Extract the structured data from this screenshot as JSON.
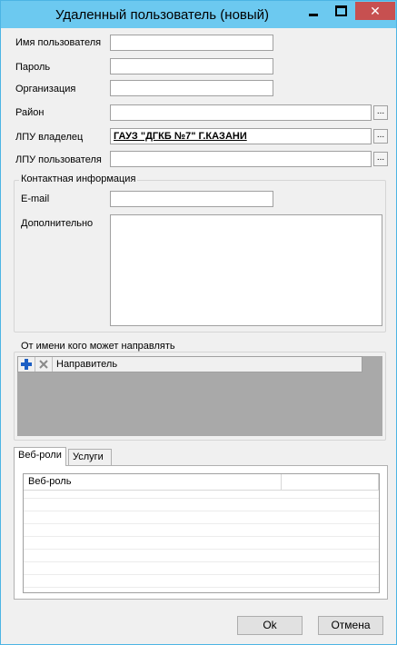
{
  "window": {
    "title": "Удаленный пользователь (новый)",
    "close_glyph": "✕"
  },
  "form": {
    "username_label": "Имя пользователя",
    "username_value": "",
    "password_label": "Пароль",
    "password_value": "",
    "organization_label": "Организация",
    "organization_value": "",
    "district_label": "Район",
    "district_value": "",
    "lpu_owner_label": "ЛПУ владелец",
    "lpu_owner_value": "ГАУЗ \"ДГКБ №7\" Г.КАЗАНИ",
    "lpu_user_label": "ЛПУ пользователя",
    "lpu_user_value": "",
    "picker_glyph": "..."
  },
  "contact": {
    "group_title": "Контактная информация",
    "email_label": "E-mail",
    "email_value": "",
    "additional_label": "Дополнительно",
    "additional_value": ""
  },
  "senders": {
    "group_title": "От имени кого может направлять",
    "column": "Направитель",
    "add_icon": "plus-icon",
    "delete_icon": "delete-icon"
  },
  "tabs": [
    {
      "label": "Веб-роли",
      "active": true
    },
    {
      "label": "Услуги",
      "active": false
    }
  ],
  "web_roles_table": {
    "columns": [
      "Веб-роль",
      ""
    ]
  },
  "buttons": {
    "ok": "Ok",
    "cancel": "Отмена"
  }
}
